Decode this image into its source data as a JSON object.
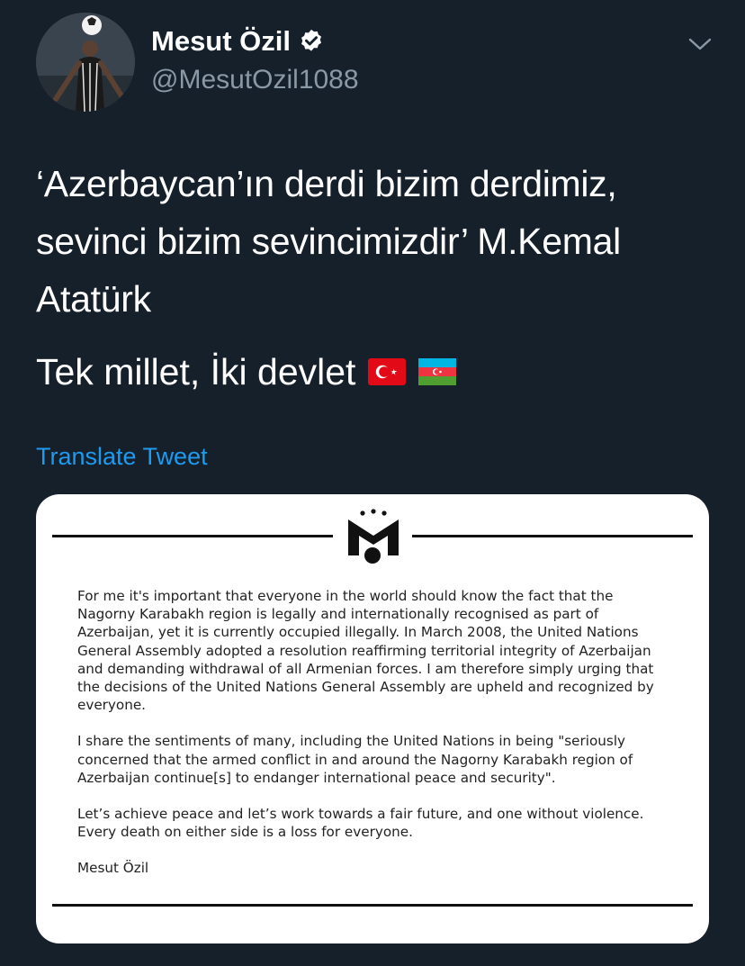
{
  "author": {
    "name": "Mesut Özil",
    "handle": "@MesutOzil1088",
    "verified": true
  },
  "tweet": {
    "text_main": "‘Azerbaycan’ın derdi bizim derdimiz, sevinci bizim sevincimizdir’ M.Kemal Atatürk",
    "text_second": "Tek millet, İki devlet",
    "flags": [
      "turkey-flag-icon",
      "azerbaijan-flag-icon"
    ],
    "translate_label": "Translate Tweet"
  },
  "media": {
    "paragraphs": [
      "For me it's important that everyone in the world should know the fact that the Nagorny Karabakh region is legally and internationally recognised as part of Azerbaijan, yet it is currently occupied illegally. In March 2008, the United Nations General Assembly adopted a resolution reaffirming territorial integrity of Azerbaijan and demanding withdrawal of all Armenian forces. I am therefore simply urging that the decisions of the United Nations General Assembly are upheld and recognized by everyone.",
      "I share the sentiments of many, including the United Nations in being \"seriously concerned that the armed conflict in and around the Nagorny Karabakh region of Azerbaijan continue[s] to endanger international peace and security\".",
      "Let’s achieve peace and let’s work towards a fair future, and one without violence. Every death on either side is a loss for everyone."
    ],
    "signature": "Mesut Özil"
  },
  "colors": {
    "background": "#15202b",
    "accent": "#1d9bf0",
    "secondary_text": "#8b98a5"
  }
}
